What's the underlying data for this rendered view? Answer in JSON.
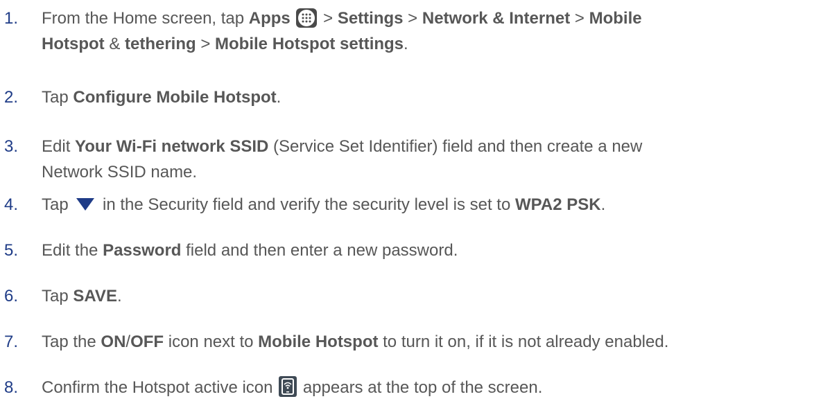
{
  "steps": [
    {
      "number": "1.",
      "line1_a": "From the Home screen, tap ",
      "line1_apps": "Apps",
      "apps_icon": "apps-grid-icon",
      "line1_sep1": " > ",
      "line1_settings": "Settings",
      "line1_sep2": " > ",
      "line1_network": "Network & Internet",
      "line1_sep3": " > ",
      "line1_mobile": "Mobile",
      "line2_hotspot": "Hotspot",
      "line2_amp": " & ",
      "line2_tethering": "tethering",
      "line2_sep": " > ",
      "line2_settings": "Mobile Hotspot settings",
      "line2_end": "."
    },
    {
      "number": "2.",
      "a": "Tap ",
      "b1": "Configure Mobile Hotspot",
      "c": "."
    },
    {
      "number": "3.",
      "a": "Edit ",
      "b1": "Your Wi-Fi network SSID",
      "c": " (Service Set Identifier) field and then create a new",
      "line2": "Network SSID name."
    },
    {
      "number": "4.",
      "a": "Tap ",
      "icon": "dropdown-triangle-icon",
      "b": " in the Security field and verify the security level is set to ",
      "b1": "WPA2 PSK",
      "c": "."
    },
    {
      "number": "5.",
      "a": "Edit the ",
      "b1": "Password",
      "c": " field and then enter a new password."
    },
    {
      "number": "6.",
      "a": "Tap ",
      "b1": "SAVE",
      "c": "."
    },
    {
      "number": "7.",
      "a": "Tap the ",
      "b1": "ON",
      "slash": "/",
      "b2": "OFF",
      "b": " icon next to ",
      "b3": "Mobile Hotspot",
      "c": " to turn it on, if it is not already enabled."
    },
    {
      "number": "8.",
      "a": "Confirm the Hotspot active icon ",
      "icon": "hotspot-active-icon",
      "c": " appears at the top of the screen."
    }
  ],
  "colors": {
    "number": "#1f3c87",
    "text": "#575757"
  }
}
